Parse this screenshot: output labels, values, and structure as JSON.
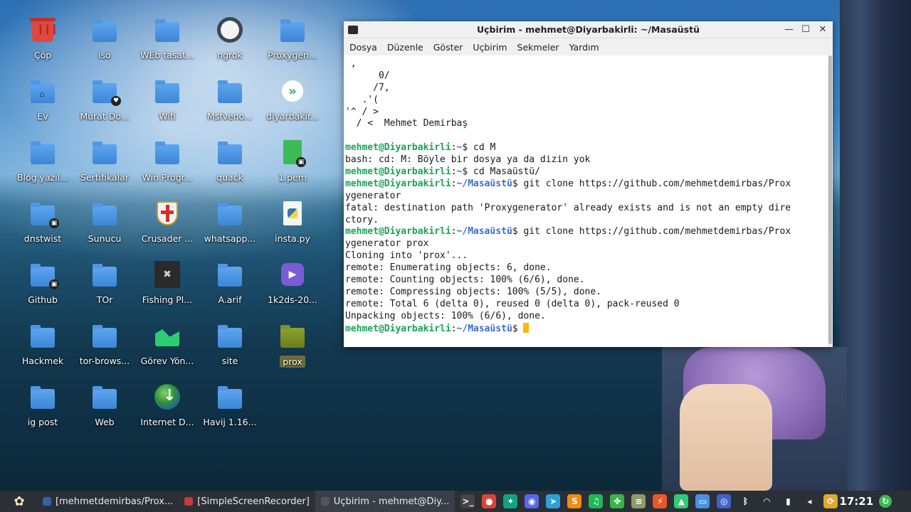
{
  "desktop": {
    "icons": [
      {
        "label": "Çöp",
        "kind": "trash-icon"
      },
      {
        "label": "iso",
        "kind": "folder-icon"
      },
      {
        "label": "WEb tasat...",
        "kind": "folder-icon"
      },
      {
        "label": "ngrok",
        "kind": "ngrok-icon"
      },
      {
        "label": "Proxygen...",
        "kind": "folder-icon"
      },
      {
        "label": "Ev",
        "kind": "home-folder-icon"
      },
      {
        "label": "Murat Do...",
        "kind": "folder-heart-icon"
      },
      {
        "label": "Wifi",
        "kind": "folder-icon"
      },
      {
        "label": "Msfveno...",
        "kind": "folder-icon"
      },
      {
        "label": "diyarbakir...",
        "kind": "remote-desktop-icon"
      },
      {
        "label": "Blog yazıl...",
        "kind": "folder-icon"
      },
      {
        "label": "Sertifikalar",
        "kind": "folder-icon"
      },
      {
        "label": "Win Progr...",
        "kind": "folder-icon"
      },
      {
        "label": "quack",
        "kind": "folder-icon"
      },
      {
        "label": "1.pem",
        "kind": "certificate-file-icon"
      },
      {
        "label": "dnstwist",
        "kind": "folder-lock-icon"
      },
      {
        "label": "Sunucu",
        "kind": "folder-icon"
      },
      {
        "label": "Crusader ...",
        "kind": "crusader-shield-icon"
      },
      {
        "label": "whatsapp...",
        "kind": "folder-icon"
      },
      {
        "label": "insta.py",
        "kind": "python-file-icon"
      },
      {
        "label": "Github",
        "kind": "folder-lock-icon"
      },
      {
        "label": "TOr",
        "kind": "folder-icon"
      },
      {
        "label": "Fishing Pl...",
        "kind": "fishing-app-icon"
      },
      {
        "label": "A.arif",
        "kind": "folder-icon"
      },
      {
        "label": "1k2ds-20...",
        "kind": "video-file-icon"
      },
      {
        "label": "Hackmek",
        "kind": "folder-icon"
      },
      {
        "label": "tor-brows...",
        "kind": "folder-icon"
      },
      {
        "label": "Görev Yön...",
        "kind": "task-manager-icon"
      },
      {
        "label": "site",
        "kind": "folder-icon"
      },
      {
        "label": "prox",
        "kind": "folder-olive-icon"
      },
      {
        "label": "ig post",
        "kind": "folder-icon"
      },
      {
        "label": "Web",
        "kind": "folder-icon"
      },
      {
        "label": "Internet D...",
        "kind": "download-manager-icon"
      },
      {
        "label": "Havij 1.16...",
        "kind": "folder-icon"
      }
    ]
  },
  "terminal": {
    "title": "Uçbirim - mehmet@Diyarbakirli: ~/Masaüstü",
    "menu": [
      "Dosya",
      "Düzenle",
      "Göster",
      "Uçbirim",
      "Sekmeler",
      "Yardım"
    ],
    "lines": [
      {
        "text": " ,"
      },
      {
        "text": "      0/"
      },
      {
        "text": "     /7,"
      },
      {
        "text": "   .'("
      },
      {
        "text": "'^ / >"
      },
      {
        "text": "  / <  Mehmet Demirbaş"
      },
      {
        "text": ""
      },
      {
        "user": "mehmet@Diyarbakirli",
        "path": "~",
        "cmd": "$ cd M"
      },
      {
        "text": "bash: cd: M: Böyle bir dosya ya da dizin yok"
      },
      {
        "user": "mehmet@Diyarbakirli",
        "path": "~",
        "cmd": "$ cd Masaüstü/"
      },
      {
        "user": "mehmet@Diyarbakirli",
        "path": "~/Masaüstü",
        "cmd": "$ git clone https://github.com/mehmetdemirbas/Prox"
      },
      {
        "text": "ygenerator"
      },
      {
        "text": "fatal: destination path 'Proxygenerator' already exists and is not an empty dire"
      },
      {
        "text": "ctory."
      },
      {
        "user": "mehmet@Diyarbakirli",
        "path": "~/Masaüstü",
        "cmd": "$ git clone https://github.com/mehmetdemirbas/Prox"
      },
      {
        "text": "ygenerator prox"
      },
      {
        "text": "Cloning into 'prox'..."
      },
      {
        "text": "remote: Enumerating objects: 6, done."
      },
      {
        "text": "remote: Counting objects: 100% (6/6), done."
      },
      {
        "text": "remote: Compressing objects: 100% (5/5), done."
      },
      {
        "text": "remote: Total 6 (delta 0), reused 0 (delta 0), pack-reused 0"
      },
      {
        "text": "Unpacking objects: 100% (6/6), done."
      },
      {
        "user": "mehmet@Diyarbakirli",
        "path": "~/Masaüstü",
        "cmd": "$ ",
        "cursor": true
      }
    ]
  },
  "taskbar": {
    "tasks": [
      {
        "label": "[mehmetdemirbas/Prox...",
        "color": "#3b5fa8"
      },
      {
        "label": "[SimpleScreenRecorder]",
        "color": "#c23b3b"
      },
      {
        "label": "Uçbirim - mehmet@Diy...",
        "color": "#555555",
        "active": true
      }
    ],
    "tray": [
      {
        "name": "terminal-launcher-icon",
        "glyph": ">_",
        "color": "#444"
      },
      {
        "name": "chrome-icon",
        "glyph": "●",
        "color": "#db4437"
      },
      {
        "name": "chatgpt-icon",
        "glyph": "✦",
        "color": "#10a37f"
      },
      {
        "name": "discord-icon",
        "glyph": "◉",
        "color": "#5865f2"
      },
      {
        "name": "telegram-icon",
        "glyph": "➤",
        "color": "#2aa1da"
      },
      {
        "name": "sublime-icon",
        "glyph": "S",
        "color": "#f28b0c"
      },
      {
        "name": "spotify-icon",
        "glyph": "♫",
        "color": "#1db954"
      },
      {
        "name": "clover-icon",
        "glyph": "✤",
        "color": "#35b44a"
      },
      {
        "name": "notes-icon",
        "glyph": "≡",
        "color": "#8b9b6a"
      },
      {
        "name": "burp-icon",
        "glyph": "⚡",
        "color": "#e8572a"
      },
      {
        "name": "chart-app-icon",
        "glyph": "▲",
        "color": "#2ecc71"
      },
      {
        "name": "file-manager-icon",
        "glyph": "▭",
        "color": "#4a90e2"
      },
      {
        "name": "network-icon",
        "glyph": "◎",
        "color": "#3f63c9"
      },
      {
        "name": "bluetooth-icon",
        "glyph": "ᛒ",
        "color": "#2b2f36"
      },
      {
        "name": "wifi-icon",
        "glyph": "◠",
        "color": "#2b2f36"
      },
      {
        "name": "battery-icon",
        "glyph": "▮",
        "color": "#2b2f36"
      },
      {
        "name": "volume-icon",
        "glyph": "◂",
        "color": "#2b2f36"
      },
      {
        "name": "update-icon",
        "glyph": "⟳",
        "color": "#e0a82e"
      }
    ],
    "clock": "17:21"
  }
}
